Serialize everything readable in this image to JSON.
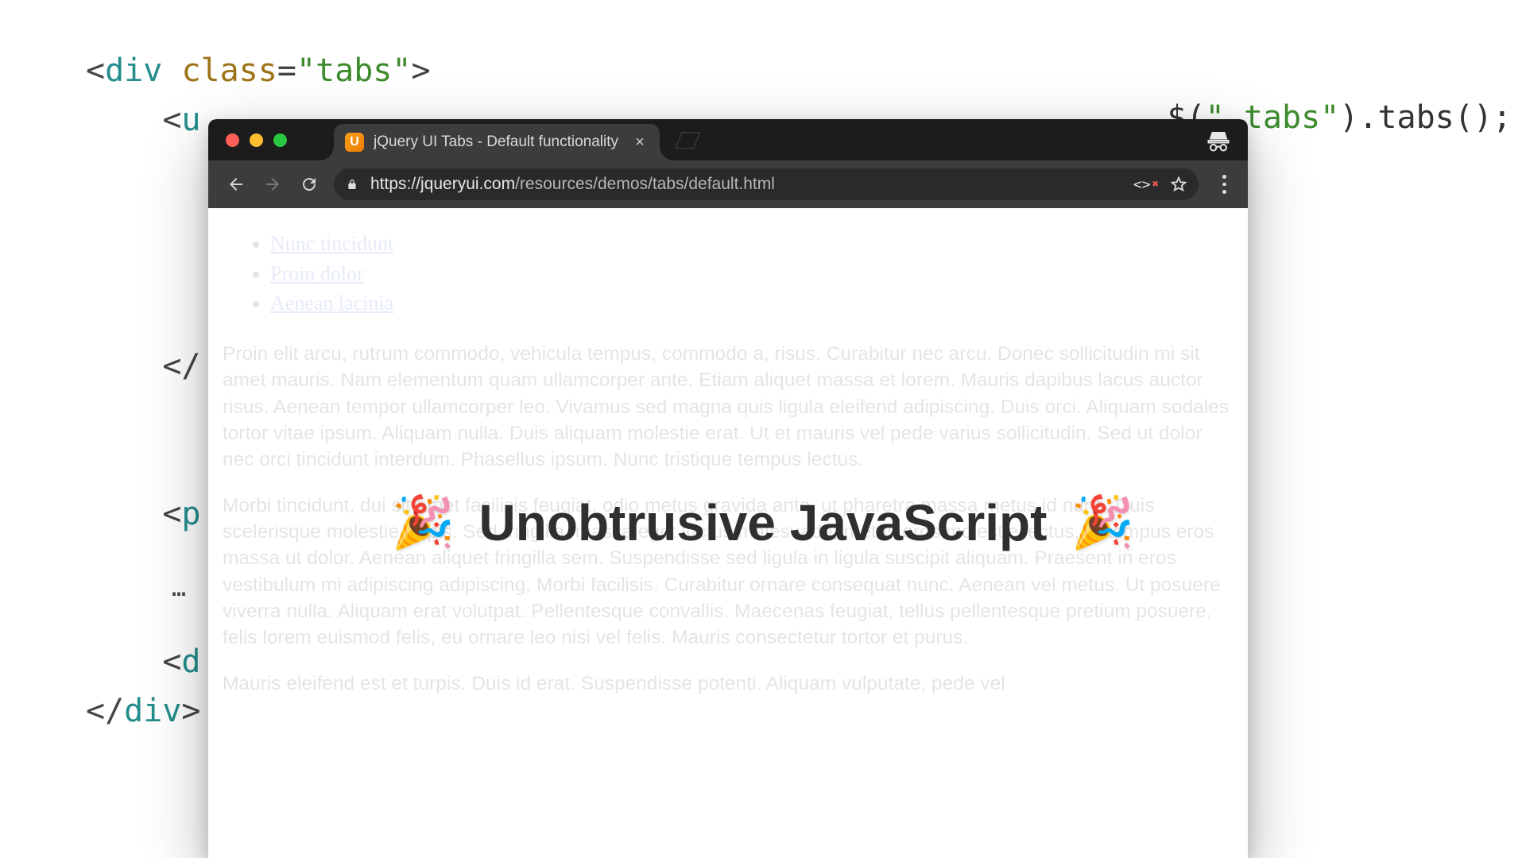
{
  "bg_code": {
    "lines": [
      {
        "raw": "<div class=\"tabs\">",
        "indent": 0,
        "tokens": [
          {
            "t": "<",
            "c": "c-punc"
          },
          {
            "t": "div",
            "c": "c-tag"
          },
          {
            "t": " ",
            "c": "c-txt"
          },
          {
            "t": "class",
            "c": "c-attr"
          },
          {
            "t": "=",
            "c": "c-punc"
          },
          {
            "t": "\"tabs\"",
            "c": "c-str"
          },
          {
            "t": ">",
            "c": "c-punc"
          }
        ]
      },
      {
        "raw": "<u",
        "indent": 1,
        "tokens": [
          {
            "t": "<",
            "c": "c-punc"
          },
          {
            "t": "u",
            "c": "c-tag"
          }
        ]
      },
      {
        "raw": "",
        "indent": 1,
        "tokens": []
      },
      {
        "raw": "",
        "indent": 1,
        "tokens": []
      },
      {
        "raw": "",
        "indent": 1,
        "tokens": []
      },
      {
        "raw": "",
        "indent": 1,
        "tokens": []
      },
      {
        "raw": "</",
        "indent": 1,
        "tokens": [
          {
            "t": "</",
            "c": "c-punc"
          }
        ]
      },
      {
        "raw": "",
        "indent": 1,
        "tokens": []
      },
      {
        "raw": "",
        "indent": 1,
        "tokens": []
      },
      {
        "raw": "<p",
        "indent": 1,
        "tokens": [
          {
            "t": "<",
            "c": "c-punc"
          },
          {
            "t": "p",
            "c": "c-tag"
          }
        ]
      },
      {
        "raw": "",
        "indent": 1,
        "tokens": []
      },
      {
        "raw": "",
        "indent": 1,
        "tokens": []
      },
      {
        "raw": "<d",
        "indent": 1,
        "tokens": [
          {
            "t": "<",
            "c": "c-punc"
          },
          {
            "t": "d",
            "c": "c-tag"
          }
        ]
      },
      {
        "raw": "</div>",
        "indent": 0,
        "tokens": [
          {
            "t": "</",
            "c": "c-punc"
          },
          {
            "t": "div",
            "c": "c-tag"
          },
          {
            "t": ">",
            "c": "c-punc"
          }
        ]
      }
    ],
    "right": {
      "tokens": [
        {
          "t": "$(",
          "c": "c-js1"
        },
        {
          "t": "\".tabs\"",
          "c": "c-js2"
        },
        {
          "t": ").tabs();",
          "c": "c-js1"
        }
      ]
    },
    "ellipsis": "…"
  },
  "browser": {
    "tab_title": "jQuery UI Tabs - Default functionality",
    "url_scheme": "https://",
    "url_host": "jqueryui.com",
    "url_path": "/resources/demos/tabs/default.html",
    "favicon_letter": "U",
    "ext_glyph": "<>",
    "ext_x": "✖"
  },
  "page": {
    "tabs": [
      {
        "label": "Nunc tincidunt"
      },
      {
        "label": "Proin dolor"
      },
      {
        "label": "Aenean lacinia"
      }
    ],
    "p1": "Proin elit arcu, rutrum commodo, vehicula tempus, commodo a, risus. Curabitur nec arcu. Donec sollicitudin mi sit amet mauris. Nam elementum quam ullamcorper ante. Etiam aliquet massa et lorem. Mauris dapibus lacus auctor risus. Aenean tempor ullamcorper leo. Vivamus sed magna quis ligula eleifend adipiscing. Duis orci. Aliquam sodales tortor vitae ipsum. Aliquam nulla. Duis aliquam molestie erat. Ut et mauris vel pede varius sollicitudin. Sed ut dolor nec orci tincidunt interdum. Phasellus ipsum. Nunc tristique tempus lectus.",
    "p2": "Morbi tincidunt, dui sit amet facilisis feugiat, odio metus gravida ante, ut pharetra massa metus id nunc. Duis scelerisque molestie turpis. Sed fringilla, massa eget luctus malesuada, metus eros molestie lectus, ut tempus eros massa ut dolor. Aenean aliquet fringilla sem. Suspendisse sed ligula in ligula suscipit aliquam. Praesent in eros vestibulum mi adipiscing adipiscing. Morbi facilisis. Curabitur ornare consequat nunc. Aenean vel metus. Ut posuere viverra nulla. Aliquam erat volutpat. Pellentesque convallis. Maecenas feugiat, tellus pellentesque pretium posuere, felis lorem euismod felis, eu ornare leo nisi vel felis. Mauris consectetur tortor et purus.",
    "p3": "Mauris eleifend est et turpis. Duis id erat. Suspendisse potenti. Aliquam vulputate, pede vel"
  },
  "caption": {
    "emoji": "🎉",
    "text": "Unobtrusive JavaScript"
  }
}
